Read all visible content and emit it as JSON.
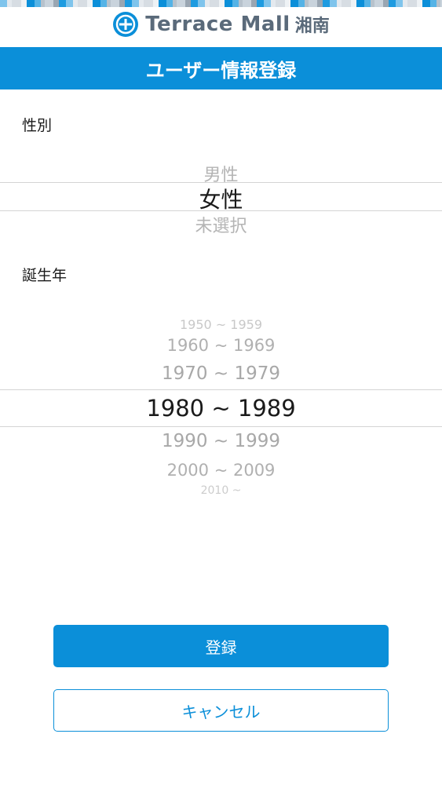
{
  "colors": {
    "brand": "#0b8fd9",
    "text": "#1a1a1a",
    "picker_faded": "#a8a8a8",
    "divider": "#d4d4d4",
    "stripe": [
      "#7fc4ec",
      "#c9d3dc",
      "#0b8fd9",
      "#e4e9ee",
      "#9aa6b2",
      "#55b3e6",
      "#d7dde3",
      "#1e9be0",
      "#b7c2cc",
      "#eef2f5"
    ]
  },
  "header": {
    "logo_icon": "terrace-mall-logo-icon",
    "logo_text": "Terrace Mall",
    "logo_sub": "湘南"
  },
  "title_bar": {
    "title": "ユーザー情報登録"
  },
  "gender": {
    "label": "性別",
    "options": [
      "男性",
      "女性",
      "未選択"
    ],
    "selected": "女性"
  },
  "birth_year": {
    "label": "誕生年",
    "options": [
      "1950 ~ 1959",
      "1960 ~ 1969",
      "1970 ~ 1979",
      "1980 ~ 1989",
      "1990 ~ 1999",
      "2000 ~ 2009",
      "2010 ~"
    ],
    "selected": "1980 ~ 1989"
  },
  "buttons": {
    "register": "登録",
    "cancel": "キャンセル"
  }
}
